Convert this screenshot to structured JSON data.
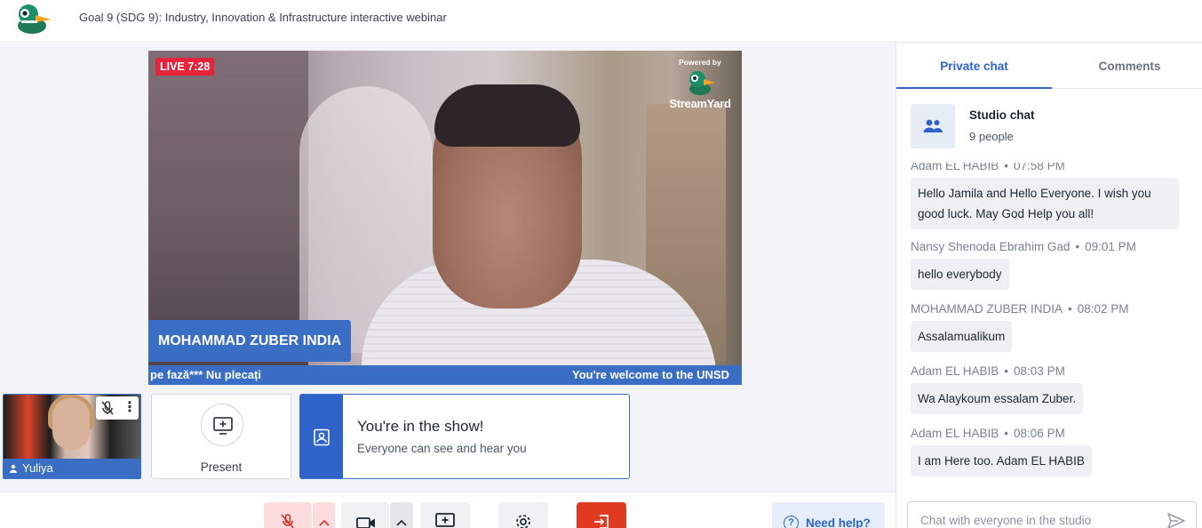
{
  "header": {
    "title": "Goal 9 (SDG 9): Industry, Innovation & Infrastructure interactive webinar"
  },
  "stage": {
    "live_label": "LIVE 7:28",
    "powered_by": "Powered by",
    "brand": "StreamYard",
    "nameplate": "MOHAMMAD ZUBER INDIA",
    "ticker_left": "pe fază*** Nu plecați",
    "ticker_right": "You're welcome to the UNSD"
  },
  "participants": [
    {
      "name": "Yuliya"
    }
  ],
  "present": {
    "label": "Present"
  },
  "show_status": {
    "title": "You're in the show!",
    "subtitle": "Everyone can see and hear you"
  },
  "toolbar": {
    "help_label": "Need help?"
  },
  "chat": {
    "tabs": [
      {
        "label": "Private chat",
        "active": true
      },
      {
        "label": "Comments",
        "active": false
      }
    ],
    "studio": {
      "title": "Studio chat",
      "count": "9 people"
    },
    "messages": [
      {
        "author": "Adam EL HABIB",
        "time": "07:58 PM",
        "text": "Hello Jamila and Hello Everyone. I wish you good luck. May God Help you all!"
      },
      {
        "author": "Nansy Shenoda Ebrahim Gad",
        "time": "09:01 PM",
        "text": "hello everybody"
      },
      {
        "author": "MOHAMMAD ZUBER INDIA",
        "time": "08:02 PM",
        "text": "Assalamualikum"
      },
      {
        "author": "Adam EL HABIB",
        "time": "08:03 PM",
        "text": "Wa Alaykoum essalam Zuber."
      },
      {
        "author": "Adam EL HABIB",
        "time": "08:06 PM",
        "text": "I am Here too. Adam EL HABIB"
      }
    ],
    "separator": "•",
    "input_placeholder": "Chat with everyone in the studio"
  },
  "colors": {
    "accent": "#2f63c9",
    "live": "#e5243b",
    "leave": "#e03a21",
    "mic_muted_bg": "#fcdcdc"
  }
}
